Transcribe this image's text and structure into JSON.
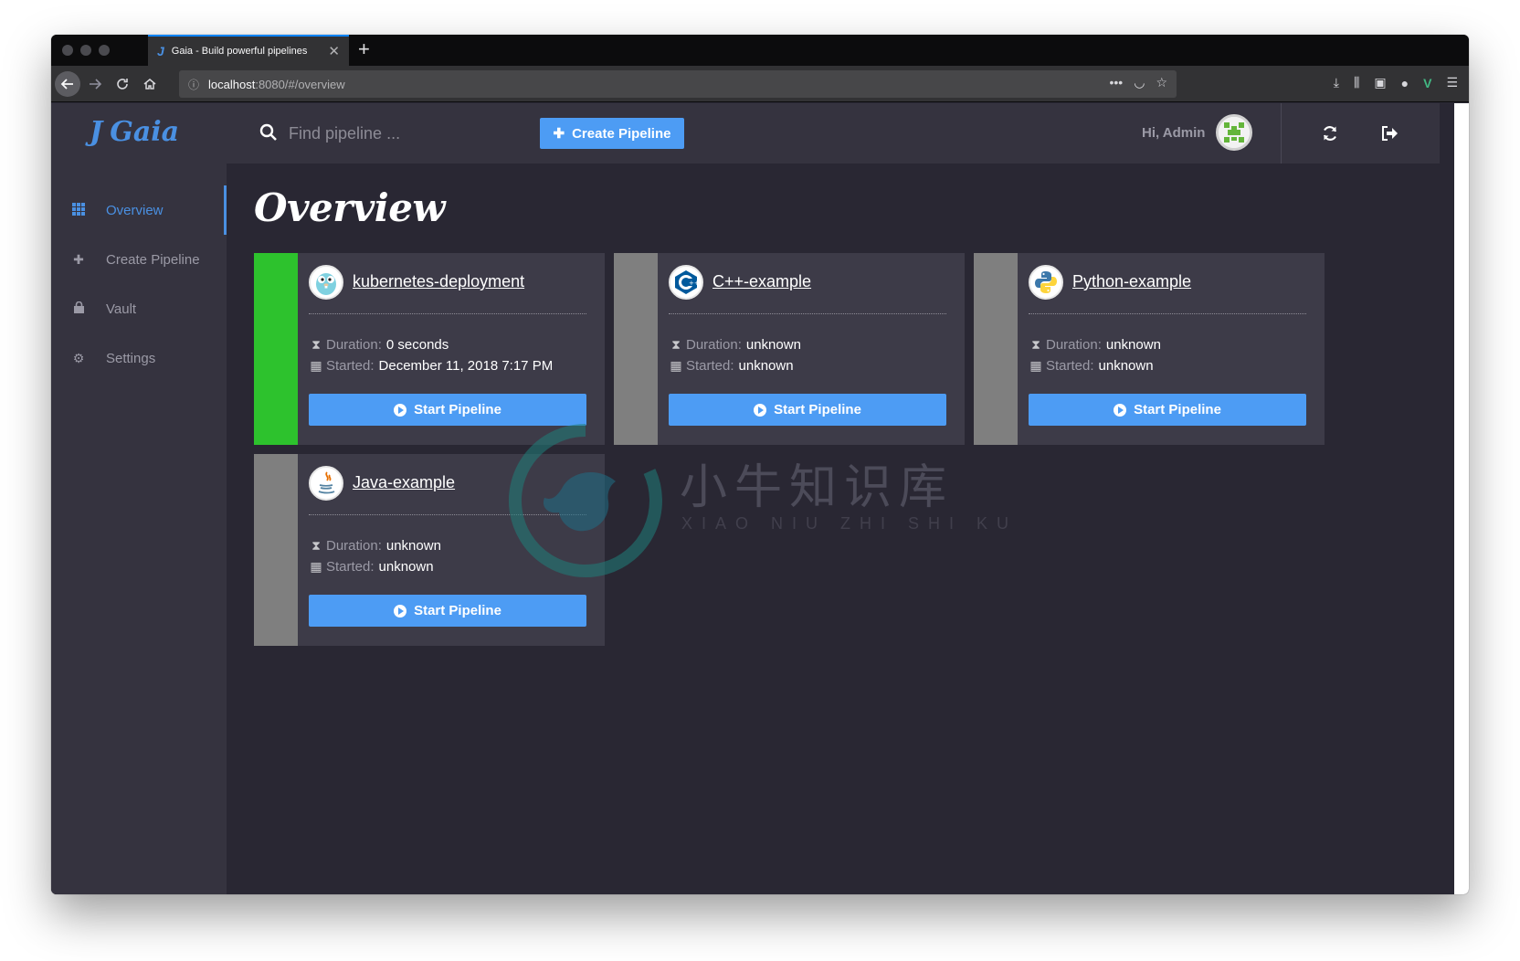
{
  "browser": {
    "tab_title": "Gaia - Build powerful pipelines",
    "url_host": "localhost",
    "url_rest": ":8080/#/overview"
  },
  "app": {
    "logo_text": "Gaia",
    "search": {
      "placeholder": "Find pipeline ..."
    },
    "create_button_label": "Create Pipeline",
    "greeting": "Hi, Admin",
    "page_title": "Overview"
  },
  "sidebar": {
    "items": [
      {
        "label": "Overview",
        "icon": "grid-icon",
        "active": true
      },
      {
        "label": "Create Pipeline",
        "icon": "plus-icon",
        "active": false
      },
      {
        "label": "Vault",
        "icon": "lock-icon",
        "active": false
      },
      {
        "label": "Settings",
        "icon": "gears-icon",
        "active": false
      }
    ]
  },
  "pipelines": [
    {
      "name": "kubernetes-deployment",
      "language_icon": "go-gopher-icon",
      "status_color": "#2dc22d",
      "duration_label": "Duration:",
      "duration": "0 seconds",
      "started_label": "Started:",
      "started": "December 11, 2018 7:17 PM",
      "button_label": "Start Pipeline"
    },
    {
      "name": "C++-example",
      "language_icon": "cpp-icon",
      "status_color": "#7f7f7f",
      "duration_label": "Duration:",
      "duration": "unknown",
      "started_label": "Started:",
      "started": "unknown",
      "button_label": "Start Pipeline"
    },
    {
      "name": "Python-example",
      "language_icon": "python-icon",
      "status_color": "#7f7f7f",
      "duration_label": "Duration:",
      "duration": "unknown",
      "started_label": "Started:",
      "started": "unknown",
      "button_label": "Start Pipeline"
    },
    {
      "name": "Java-example",
      "language_icon": "java-icon",
      "status_color": "#7f7f7f",
      "duration_label": "Duration:",
      "duration": "unknown",
      "started_label": "Started:",
      "started": "unknown",
      "button_label": "Start Pipeline"
    }
  ],
  "watermark": {
    "text": "小牛知识库",
    "subtext": "XIAO NIU ZHI SHI KU"
  },
  "colors": {
    "accent": "#4d9cf4",
    "success": "#2dc22d",
    "unknown": "#7f7f7f",
    "background": "#292733",
    "panel": "#35333f"
  }
}
